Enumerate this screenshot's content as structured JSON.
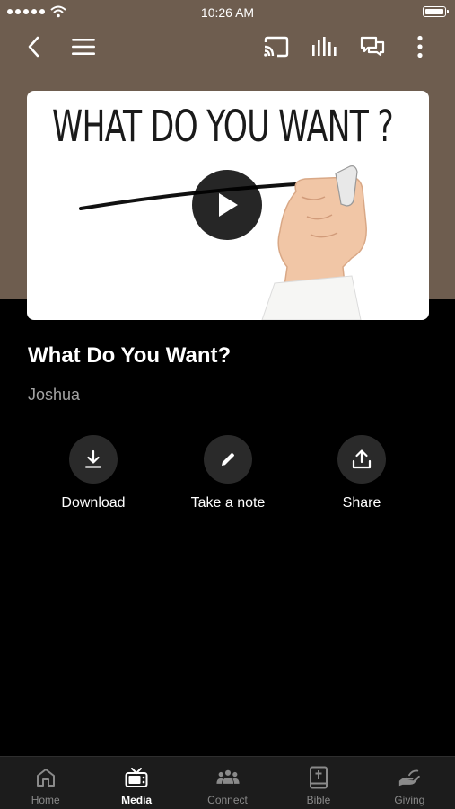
{
  "status_bar": {
    "time": "10:26 AM"
  },
  "media": {
    "thumbnail_text": "WHAT DO YOU WANT ?",
    "title": "What Do You Want?",
    "speaker": "Joshua"
  },
  "actions": [
    {
      "label": "Download",
      "icon": "download-icon"
    },
    {
      "label": "Take a note",
      "icon": "pencil-icon"
    },
    {
      "label": "Share",
      "icon": "share-icon"
    }
  ],
  "tabs": [
    {
      "label": "Home",
      "icon": "home-icon",
      "active": false
    },
    {
      "label": "Media",
      "icon": "tv-icon",
      "active": true
    },
    {
      "label": "Connect",
      "icon": "people-icon",
      "active": false
    },
    {
      "label": "Bible",
      "icon": "bible-icon",
      "active": false
    },
    {
      "label": "Giving",
      "icon": "giving-hand-icon",
      "active": false
    }
  ],
  "colors": {
    "header_background": "#6e5d4f",
    "background": "#000000",
    "tab_bar": "#1c1c1c",
    "action_circle": "#2a2a2a",
    "secondary_text": "#a3a3a3"
  }
}
